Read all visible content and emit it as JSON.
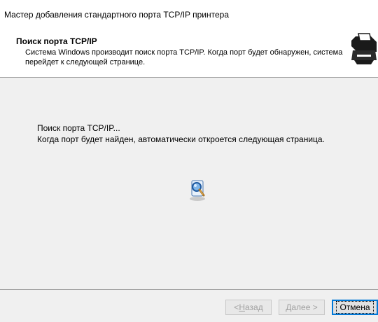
{
  "window": {
    "title": "Мастер добавления стандартного порта TCP/IP принтера"
  },
  "header": {
    "heading": "Поиск порта TCP/IP",
    "description": "Система Windows производит поиск порта TCP/IP. Когда порт будет обнаружен, система перейдет к следующей странице.",
    "logo_icon": "printer-network-icon"
  },
  "content": {
    "status_line1": "Поиск порта TCP/IP...",
    "status_line2": "Когда порт будет найден, автоматически откроется следующая страница.",
    "animation_icon": "search-magnifier-icon"
  },
  "footer": {
    "back_prefix": "< ",
    "back_hotkey": "Н",
    "back_rest": "азад",
    "next_hotkey": "Д",
    "next_rest": "алее >",
    "cancel_label": "Отмена"
  },
  "colors": {
    "content_bg": "#f0f0f0",
    "accent": "#0078d7"
  }
}
